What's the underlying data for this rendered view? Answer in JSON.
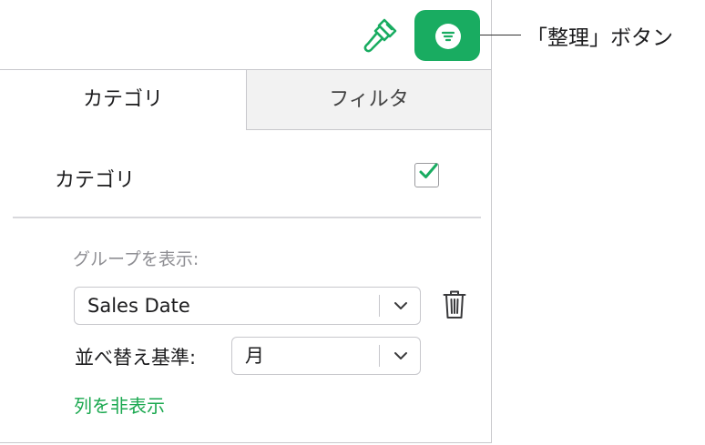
{
  "colors": {
    "accent": "#19ac61",
    "link": "#1aa84f",
    "muted": "#8e8e93"
  },
  "toolbar": {
    "format_icon": "paintbrush-icon",
    "organize_icon": "organize-filter-icon",
    "callout_label": "「整理」ボタン"
  },
  "tabs": [
    {
      "label": "カテゴリ",
      "selected": true
    },
    {
      "label": "フィルタ",
      "selected": false
    }
  ],
  "categories": {
    "label": "カテゴリ",
    "enabled": true,
    "group_by_caption": "グループを表示:",
    "group_by_value": "Sales Date",
    "delete_icon": "trash-icon",
    "sort_label": "並べ替え基準:",
    "sort_value": "月",
    "hide_column_link": "列を非表示"
  }
}
